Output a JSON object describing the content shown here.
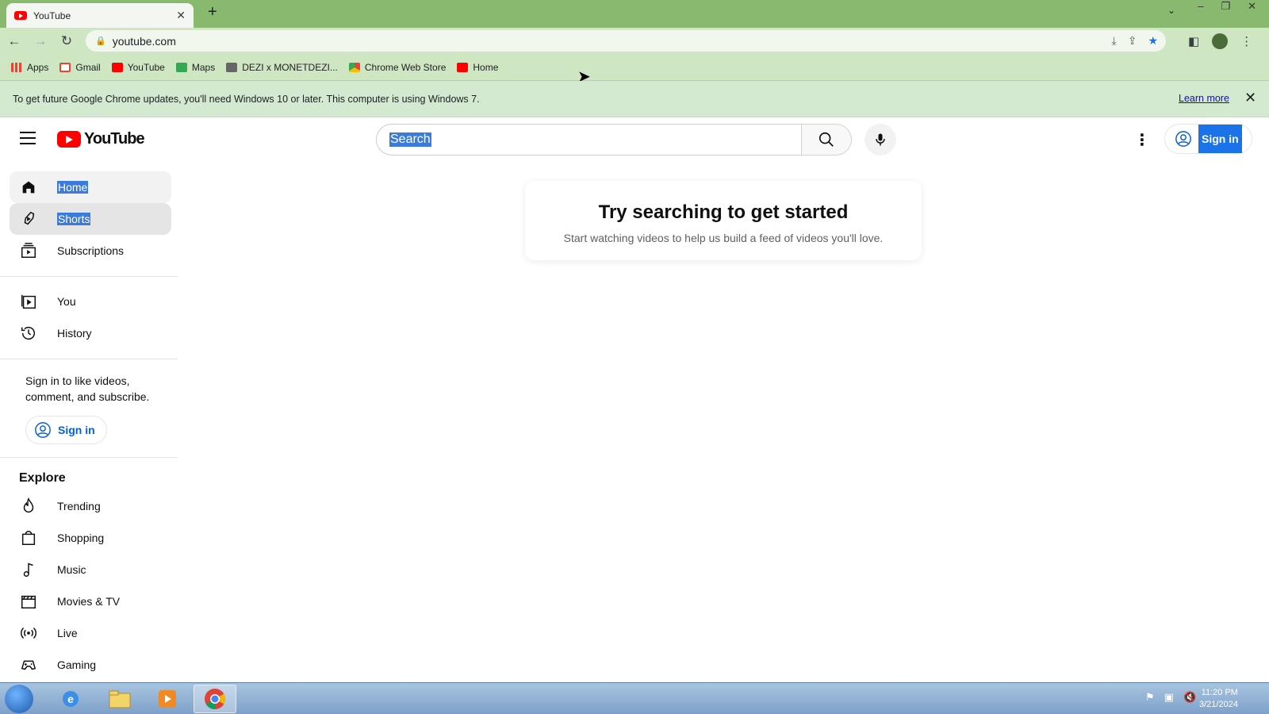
{
  "browser": {
    "tab_title": "YouTube",
    "address": "youtube.com",
    "bookmarks": [
      "Apps",
      "Gmail",
      "YouTube",
      "Maps",
      "DEZI x MONETDEZI...",
      "Chrome Web Store",
      "Home"
    ],
    "infobar_text": "To get future Google Chrome updates, you'll need Windows 10 or later. This computer is using Windows 7.",
    "infobar_link": "Learn more"
  },
  "masthead": {
    "logo_text": "YouTube",
    "search_placeholder": "Search",
    "sign_in": "Sign in"
  },
  "sidebar": {
    "main": [
      "Home",
      "Shorts",
      "Subscriptions"
    ],
    "you": [
      "You",
      "History"
    ],
    "signin_prompt": "Sign in to like videos, comment, and subscribe.",
    "signin_button": "Sign in",
    "explore_title": "Explore",
    "explore": [
      "Trending",
      "Shopping",
      "Music",
      "Movies & TV",
      "Live",
      "Gaming"
    ]
  },
  "main": {
    "card_title": "Try searching to get started",
    "card_subtitle": "Start watching videos to help us build a feed of videos you'll love."
  },
  "taskbar": {
    "time": "11:20 PM",
    "date": "3/21/2024"
  },
  "colors": {
    "chrome_frame": "#89b96f",
    "toolbar": "#cfe6c3",
    "youtube_red": "#ff0000",
    "selection_blue": "#3b7bdb"
  }
}
